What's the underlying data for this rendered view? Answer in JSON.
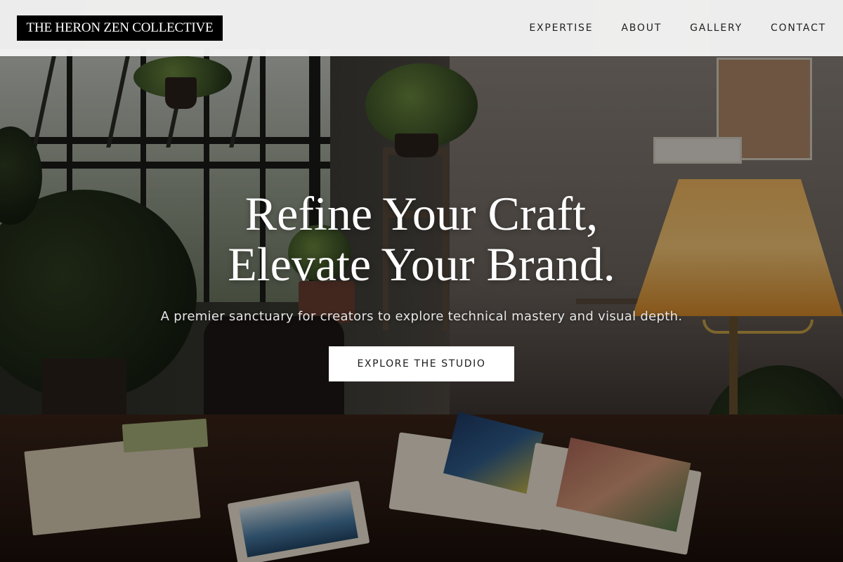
{
  "header": {
    "logo_text": "THE HERON ZEN COLLECTIVE",
    "nav": [
      {
        "label": "EXPERTISE"
      },
      {
        "label": "ABOUT"
      },
      {
        "label": "GALLERY"
      },
      {
        "label": "CONTACT"
      }
    ]
  },
  "hero": {
    "title_line1": "Refine Your Craft,",
    "title_line2": "Elevate Your Brand.",
    "subtitle": "A premier sanctuary for creators to explore technical mastery and visual depth.",
    "cta_label": "EXPLORE THE STUDIO",
    "background_image": "artist-studio-desk-with-plants-and-lamp"
  },
  "colors": {
    "header_bg": "#f4f4f4",
    "logo_bg": "#000000",
    "logo_text": "#ffffff",
    "nav_text": "#222222",
    "hero_text": "#ffffff",
    "cta_bg": "#ffffff",
    "cta_text": "#1a1a1a"
  }
}
